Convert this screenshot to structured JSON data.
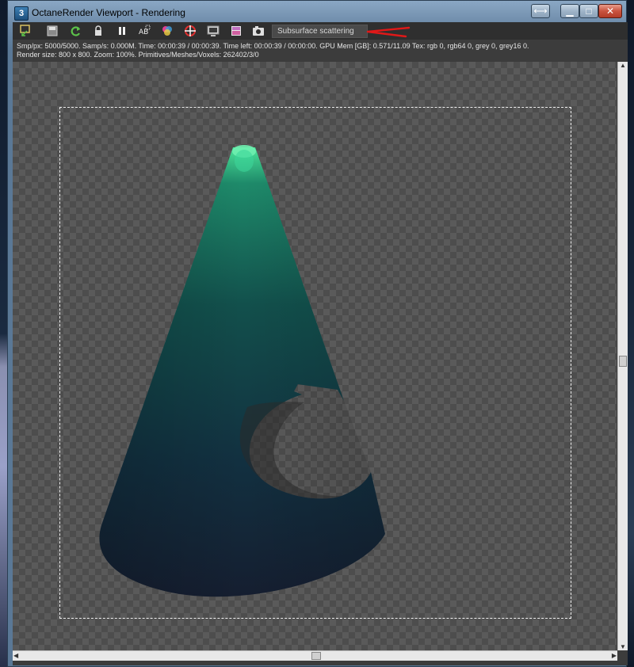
{
  "window": {
    "title": "OctaneRender Viewport - Rendering",
    "app_icon_text": "3",
    "controls": [
      "resize-icon",
      "minimize-icon",
      "maximize-icon",
      "close-icon"
    ]
  },
  "toolbar": {
    "icons": [
      {
        "name": "send-to-frame-buffer-icon",
        "color": "#d8c060"
      },
      {
        "name": "save-render-icon",
        "color": "#b8b8b8"
      },
      {
        "name": "restart-render-icon",
        "color": "#5cc24a"
      },
      {
        "name": "lock-viewport-icon",
        "color": "#d8d8d8"
      },
      {
        "name": "pause-icon",
        "color": "#f0f0f0"
      },
      {
        "name": "render-region-icon",
        "color": "#f0f0f0"
      },
      {
        "name": "color-picker-icon",
        "color": "#e04090"
      },
      {
        "name": "focus-picker-icon",
        "color": "#e03030"
      },
      {
        "name": "viewport-settings-icon",
        "color": "#c0c0c0"
      },
      {
        "name": "material-picker-icon",
        "color": "#c070c0"
      },
      {
        "name": "camera-icon",
        "color": "#e0e0e0"
      }
    ],
    "render_mode": "Subsurface scattering"
  },
  "info": {
    "line1": "Smp/px: 5000/5000.   Samp/s: 0.000M.   Time: 00:00:39 / 00:00:39.   Time left: 00:00:39 / 00:00:00.   GPU Mem [GB]: 0.571/11.09   Tex: rgb 0, rgb64 0, grey 0, grey16 0.",
    "line2": "Render size: 800 x 800.   Zoom: 100%.   Primitives/Meshes/Voxels: 262402/3/0"
  },
  "colors": {
    "accent_arrow": "#e01818",
    "cone_tip": "#4be59a",
    "cone_body": "#12383a",
    "cone_base": "#151e30"
  }
}
